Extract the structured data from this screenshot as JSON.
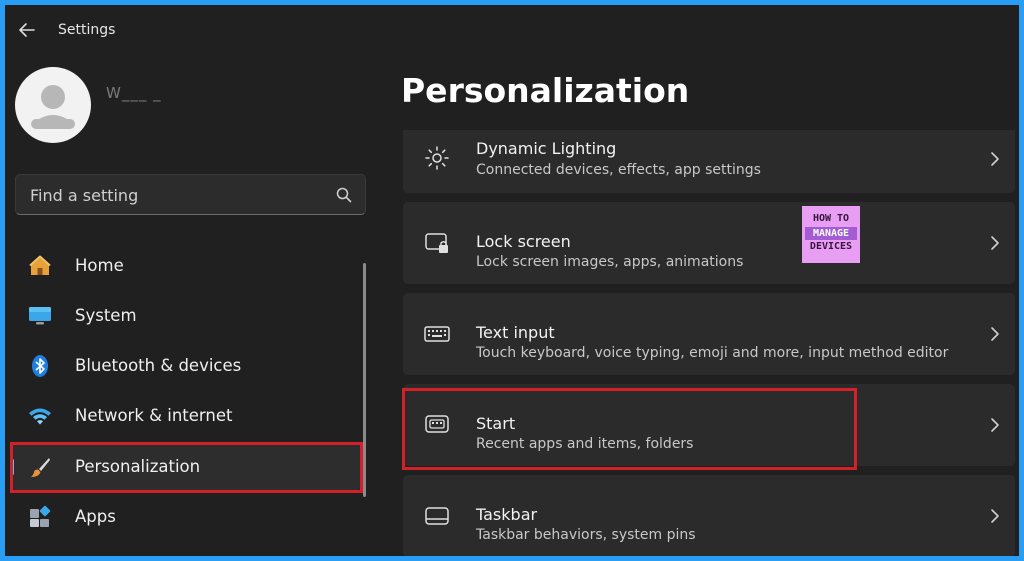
{
  "app": {
    "title": "Settings"
  },
  "user": {
    "name": "W___ _"
  },
  "search": {
    "placeholder": "Find a setting"
  },
  "sidebar": {
    "items": [
      {
        "label": "Home",
        "icon": "home-icon"
      },
      {
        "label": "System",
        "icon": "monitor-icon"
      },
      {
        "label": "Bluetooth & devices",
        "icon": "bluetooth-icon"
      },
      {
        "label": "Network & internet",
        "icon": "wifi-icon"
      },
      {
        "label": "Personalization",
        "icon": "brush-icon",
        "selected": true
      },
      {
        "label": "Apps",
        "icon": "apps-icon"
      }
    ]
  },
  "main": {
    "title": "Personalization",
    "cards": [
      {
        "title": "Dynamic Lighting",
        "subtitle": "Connected devices, effects, app settings",
        "icon": "dynamic-lighting-icon"
      },
      {
        "title": "Lock screen",
        "subtitle": "Lock screen images, apps, animations",
        "icon": "lock-screen-icon"
      },
      {
        "title": "Text input",
        "subtitle": "Touch keyboard, voice typing, emoji and more, input method editor",
        "icon": "keyboard-icon"
      },
      {
        "title": "Start",
        "subtitle": "Recent apps and items, folders",
        "icon": "start-icon"
      },
      {
        "title": "Taskbar",
        "subtitle": "Taskbar behaviors, system pins",
        "icon": "taskbar-icon"
      }
    ]
  },
  "watermark": {
    "line1": "HOW TO",
    "line2": "MANAGE",
    "line3": "DEVICES"
  },
  "colors": {
    "accent": "#4cc2ff",
    "highlight": "#d4202a",
    "background": "#202020",
    "card": "#2b2b2b",
    "border": "#2a9df4"
  }
}
